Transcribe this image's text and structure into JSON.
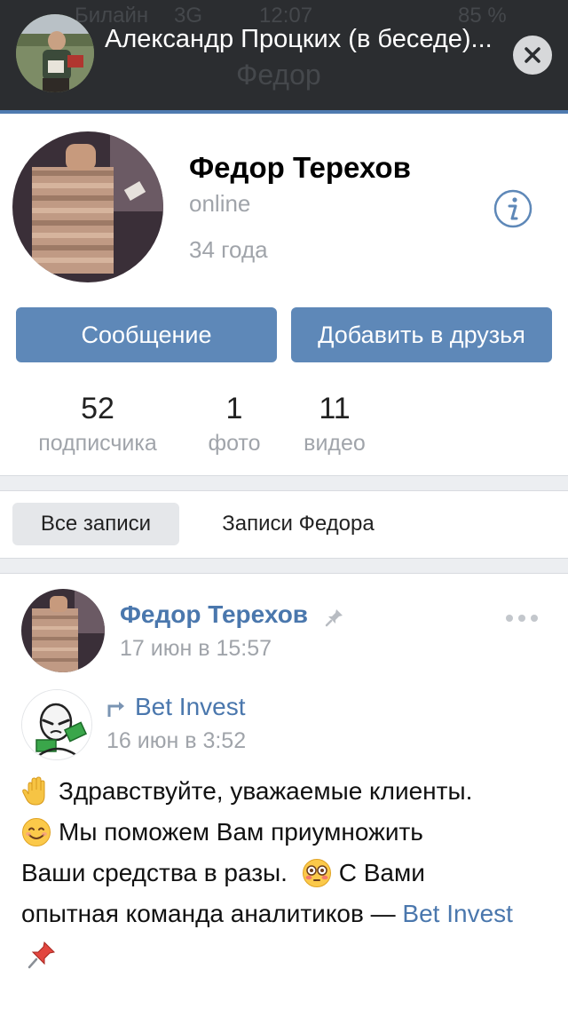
{
  "status_bar_ghost": {
    "carrier": "Билайн",
    "network": "3G",
    "time": "12:07",
    "battery": "85 %"
  },
  "ghost_header_name": "Федор",
  "notification": {
    "title": "Александр Процких (в беседе)...",
    "close_icon": "close-icon"
  },
  "profile": {
    "name": "Федор Терехов",
    "status": "online",
    "age": "34 года",
    "info_icon": "info-icon"
  },
  "actions": {
    "message_label": "Сообщение",
    "add_friend_label": "Добавить в друзья"
  },
  "counters": [
    {
      "value": "52",
      "label": "подписчика"
    },
    {
      "value": "1",
      "label": "фото"
    },
    {
      "value": "11",
      "label": "видео"
    }
  ],
  "tabs": {
    "all": "Все записи",
    "own": "Записи Федора"
  },
  "post": {
    "author": "Федор Терехов",
    "date": "17 июн в 15:57",
    "repost": {
      "author": "Bet Invest",
      "date": "16 июн в 3:52"
    },
    "text": {
      "line1": "Здравствуйте, уважаемые клиенты.",
      "line2": "Мы поможем Вам приумножить",
      "line3": "Ваши средства в разы.",
      "line3b": "С Вами",
      "line4": "опытная команда аналитиков — ",
      "link": "Bet Invest"
    }
  },
  "colors": {
    "accent": "#5e88b8",
    "link": "#4a77ad",
    "banner": "#2b2d30"
  }
}
